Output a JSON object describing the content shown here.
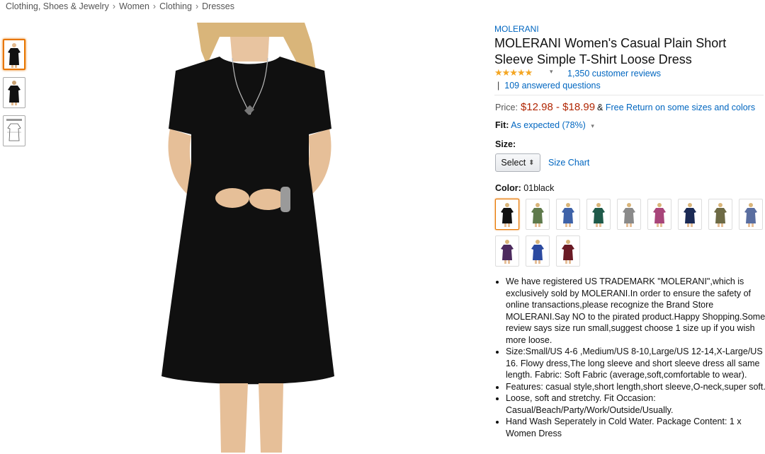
{
  "breadcrumb": [
    "Clothing, Shoes & Jewelry",
    "Women",
    "Clothing",
    "Dresses"
  ],
  "breadcrumb_sep": "›",
  "brand": "MOLERANI",
  "title": "MOLERANI Women's Casual Plain Short Sleeve Simple T-Shirt Loose Dress",
  "rating": {
    "stars": "★★★★★",
    "value": 4.5,
    "reviews": "1,350 customer reviews",
    "dropdown": "▾"
  },
  "qa": {
    "bar": "|",
    "text": "109 answered questions"
  },
  "price": {
    "label": "Price:",
    "value": "$12.98 - $18.99",
    "amp": "&",
    "link": "Free Return on some sizes and colors"
  },
  "fit": {
    "label": "Fit:",
    "value": "As expected (78%)",
    "dropdown": "▾"
  },
  "size": {
    "label": "Size:",
    "select": "Select",
    "select_icon": "⬍",
    "chart": "Size Chart"
  },
  "color": {
    "label": "Color:",
    "value": "01black"
  },
  "swatches": [
    {
      "name": "black",
      "hex": "#111111"
    },
    {
      "name": "army green",
      "hex": "#5f7a4c"
    },
    {
      "name": "blue",
      "hex": "#3e62a8"
    },
    {
      "name": "dark green",
      "hex": "#1f5a4a"
    },
    {
      "name": "gray",
      "hex": "#8a8a8a"
    },
    {
      "name": "rose",
      "hex": "#a8457a"
    },
    {
      "name": "navy",
      "hex": "#1b2a55"
    },
    {
      "name": "olive",
      "hex": "#6d6a45"
    },
    {
      "name": "denim",
      "hex": "#5a6ea0"
    },
    {
      "name": "purple",
      "hex": "#4c2a5e"
    },
    {
      "name": "royal blue",
      "hex": "#2c4aa0"
    },
    {
      "name": "burgundy",
      "hex": "#6a1a24"
    }
  ],
  "bullets": [
    "We have registered US TRADEMARK \"MOLERANI\",which is exclusively sold by MOLERANI.In order to ensure the safety of online transactions,please recognize the Brand Store MOLERANI.Say NO to the pirated product.Happy Shopping.Some review says size run small,suggest choose 1 size up if you wish more loose.",
    "Size:Small/US 4-6 ,Medium/US 8-10,Large/US 12-14,X-Large/US 16. Flowy dress,The long sleeve and short sleeve dress all same length. Fabric: Soft Fabric (average,soft,comfortable to wear).",
    "Features: casual style,short length,short sleeve,O-neck,super soft.",
    "Loose, soft and stretchy. Fit Occasion: Casual/Beach/Party/Work/Outside/Usually.",
    "Hand Wash Seperately in Cold Water. Package Content: 1 x Women Dress"
  ],
  "colors": {
    "link": "#0066c0",
    "price": "#b12704",
    "selected_border": "#e77600",
    "star": "#f4a623"
  }
}
